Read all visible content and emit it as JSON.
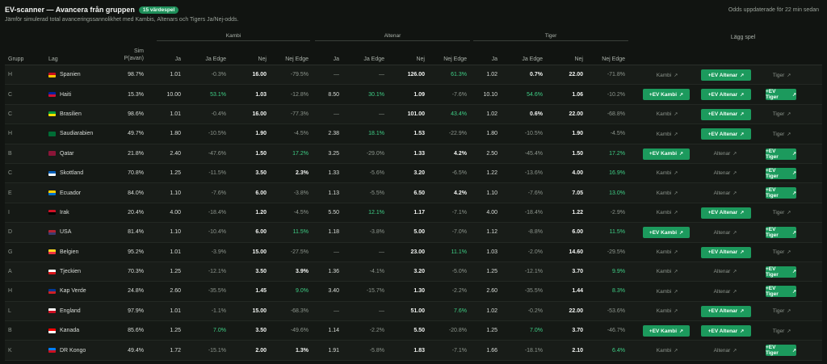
{
  "header": {
    "title": "EV-scanner — Avancera från gruppen",
    "badge": "15 värdespel",
    "subtitle": "Jämför simulerad total avanceringssannolikhet med Kambis, Altenars och Tigers Ja/Nej-odds.",
    "updated": "Odds uppdaterade för 22 min sedan"
  },
  "groups": {
    "kambi": "Kambi",
    "altenar": "Altenar",
    "tiger": "Tiger",
    "add": "Lägg spel"
  },
  "columns": {
    "grupp": "Grupp",
    "lag": "Lag",
    "sim1": "Sim",
    "sim2": "P(avan)",
    "ja": "Ja",
    "ja_edge": "Ja Edge",
    "nej": "Nej",
    "nej_edge": "Nej Edge"
  },
  "buttons": {
    "arrow": "↗"
  },
  "rows": [
    {
      "group": "H",
      "team": "Spanien",
      "flag": [
        "#c60b1e",
        "#ffc400"
      ],
      "sim": "98.7%",
      "k": [
        "1.01",
        "-0.3%",
        "16.00",
        "-79.5%"
      ],
      "a": [
        "—",
        "—",
        "126.00",
        "61.3%"
      ],
      "t": [
        "1.02",
        "0.7%",
        "22.00",
        "-71.8%"
      ],
      "kc": [
        "",
        "neg",
        "b",
        "neg"
      ],
      "ac": [
        "dim",
        "dim",
        "b",
        "pos"
      ],
      "tc": [
        "",
        "posw",
        "b",
        "neg"
      ],
      "btn": [
        {
          "label": "Kambi",
          "ev": false
        },
        {
          "label": "+EV Altenar",
          "ev": true
        },
        {
          "label": "Tiger",
          "ev": false
        }
      ]
    },
    {
      "group": "C",
      "team": "Haiti",
      "flag": [
        "#00209f",
        "#d21034"
      ],
      "sim": "15.3%",
      "k": [
        "10.00",
        "53.1%",
        "1.03",
        "-12.8%"
      ],
      "a": [
        "8.50",
        "30.1%",
        "1.09",
        "-7.6%"
      ],
      "t": [
        "10.10",
        "54.6%",
        "1.06",
        "-10.2%"
      ],
      "kc": [
        "",
        "pos",
        "b",
        "neg"
      ],
      "ac": [
        "",
        "pos",
        "b",
        "neg"
      ],
      "tc": [
        "",
        "pos",
        "b",
        "neg"
      ],
      "btn": [
        {
          "label": "+EV Kambi",
          "ev": true
        },
        {
          "label": "+EV Altenar",
          "ev": true
        },
        {
          "label": "+EV Tiger",
          "ev": true
        }
      ]
    },
    {
      "group": "C",
      "team": "Brasilien",
      "flag": [
        "#009c3b",
        "#ffdf00"
      ],
      "sim": "98.6%",
      "k": [
        "1.01",
        "-0.4%",
        "16.00",
        "-77.3%"
      ],
      "a": [
        "—",
        "—",
        "101.00",
        "43.4%"
      ],
      "t": [
        "1.02",
        "0.6%",
        "22.00",
        "-68.8%"
      ],
      "kc": [
        "",
        "neg",
        "b",
        "neg"
      ],
      "ac": [
        "dim",
        "dim",
        "b",
        "pos"
      ],
      "tc": [
        "",
        "posw",
        "b",
        "neg"
      ],
      "btn": [
        {
          "label": "Kambi",
          "ev": false
        },
        {
          "label": "+EV Altenar",
          "ev": true
        },
        {
          "label": "Tiger",
          "ev": false
        }
      ]
    },
    {
      "group": "H",
      "team": "Saudiarabien",
      "flag": [
        "#006c35",
        "#006c35"
      ],
      "sim": "49.7%",
      "k": [
        "1.80",
        "-10.5%",
        "1.90",
        "-4.5%"
      ],
      "a": [
        "2.38",
        "18.1%",
        "1.53",
        "-22.9%"
      ],
      "t": [
        "1.80",
        "-10.5%",
        "1.90",
        "-4.5%"
      ],
      "kc": [
        "",
        "neg",
        "b",
        "neg"
      ],
      "ac": [
        "",
        "pos",
        "b",
        "neg"
      ],
      "tc": [
        "",
        "neg",
        "b",
        "neg"
      ],
      "btn": [
        {
          "label": "Kambi",
          "ev": false
        },
        {
          "label": "+EV Altenar",
          "ev": true
        },
        {
          "label": "Tiger",
          "ev": false
        }
      ]
    },
    {
      "group": "B",
      "team": "Qatar",
      "flag": [
        "#8a1538",
        "#8a1538"
      ],
      "sim": "21.8%",
      "k": [
        "2.40",
        "-47.6%",
        "1.50",
        "17.2%"
      ],
      "a": [
        "3.25",
        "-29.0%",
        "1.33",
        "4.2%"
      ],
      "t": [
        "2.50",
        "-45.4%",
        "1.50",
        "17.2%"
      ],
      "kc": [
        "",
        "neg",
        "b",
        "pos"
      ],
      "ac": [
        "",
        "neg",
        "b",
        "posw"
      ],
      "tc": [
        "",
        "neg",
        "b",
        "pos"
      ],
      "btn": [
        {
          "label": "+EV Kambi",
          "ev": true
        },
        {
          "label": "Altenar",
          "ev": false
        },
        {
          "label": "+EV Tiger",
          "ev": true
        }
      ]
    },
    {
      "group": "C",
      "team": "Skottland",
      "flag": [
        "#005eb8",
        "#ffffff"
      ],
      "sim": "70.8%",
      "k": [
        "1.25",
        "-11.5%",
        "3.50",
        "2.3%"
      ],
      "a": [
        "1.33",
        "-5.6%",
        "3.20",
        "-6.5%"
      ],
      "t": [
        "1.22",
        "-13.6%",
        "4.00",
        "16.9%"
      ],
      "kc": [
        "",
        "neg",
        "b",
        "posw"
      ],
      "ac": [
        "",
        "neg",
        "b",
        "neg"
      ],
      "tc": [
        "",
        "neg",
        "b",
        "pos"
      ],
      "btn": [
        {
          "label": "Kambi",
          "ev": false
        },
        {
          "label": "Altenar",
          "ev": false
        },
        {
          "label": "+EV Tiger",
          "ev": true
        }
      ]
    },
    {
      "group": "E",
      "team": "Ecuador",
      "flag": [
        "#ffd100",
        "#0072ce"
      ],
      "sim": "84.0%",
      "k": [
        "1.10",
        "-7.6%",
        "6.00",
        "-3.8%"
      ],
      "a": [
        "1.13",
        "-5.5%",
        "6.50",
        "4.2%"
      ],
      "t": [
        "1.10",
        "-7.6%",
        "7.05",
        "13.0%"
      ],
      "kc": [
        "",
        "neg",
        "b",
        "neg"
      ],
      "ac": [
        "",
        "neg",
        "b",
        "posw"
      ],
      "tc": [
        "",
        "neg",
        "b",
        "pos"
      ],
      "btn": [
        {
          "label": "Kambi",
          "ev": false
        },
        {
          "label": "Altenar",
          "ev": false
        },
        {
          "label": "+EV Tiger",
          "ev": true
        }
      ]
    },
    {
      "group": "I",
      "team": "Irak",
      "flag": [
        "#ce1126",
        "#000000"
      ],
      "sim": "20.4%",
      "k": [
        "4.00",
        "-18.4%",
        "1.20",
        "-4.5%"
      ],
      "a": [
        "5.50",
        "12.1%",
        "1.17",
        "-7.1%"
      ],
      "t": [
        "4.00",
        "-18.4%",
        "1.22",
        "-2.9%"
      ],
      "kc": [
        "",
        "neg",
        "b",
        "neg"
      ],
      "ac": [
        "",
        "pos",
        "b",
        "neg"
      ],
      "tc": [
        "",
        "neg",
        "b",
        "neg"
      ],
      "btn": [
        {
          "label": "Kambi",
          "ev": false
        },
        {
          "label": "+EV Altenar",
          "ev": true
        },
        {
          "label": "Tiger",
          "ev": false
        }
      ]
    },
    {
      "group": "D",
      "team": "USA",
      "flag": [
        "#b22234",
        "#3c3b6e"
      ],
      "sim": "81.4%",
      "k": [
        "1.10",
        "-10.4%",
        "6.00",
        "11.5%"
      ],
      "a": [
        "1.18",
        "-3.8%",
        "5.00",
        "-7.0%"
      ],
      "t": [
        "1.12",
        "-8.8%",
        "6.00",
        "11.5%"
      ],
      "kc": [
        "",
        "neg",
        "b",
        "pos"
      ],
      "ac": [
        "",
        "neg",
        "b",
        "neg"
      ],
      "tc": [
        "",
        "neg",
        "b",
        "pos"
      ],
      "btn": [
        {
          "label": "+EV Kambi",
          "ev": true
        },
        {
          "label": "Altenar",
          "ev": false
        },
        {
          "label": "+EV Tiger",
          "ev": true
        }
      ]
    },
    {
      "group": "G",
      "team": "Belgien",
      "flag": [
        "#fdda24",
        "#ef3340"
      ],
      "sim": "95.2%",
      "k": [
        "1.01",
        "-3.9%",
        "15.00",
        "-27.5%"
      ],
      "a": [
        "—",
        "—",
        "23.00",
        "11.1%"
      ],
      "t": [
        "1.03",
        "-2.0%",
        "14.60",
        "-29.5%"
      ],
      "kc": [
        "",
        "neg",
        "b",
        "neg"
      ],
      "ac": [
        "dim",
        "dim",
        "b",
        "pos"
      ],
      "tc": [
        "",
        "neg",
        "b",
        "neg"
      ],
      "btn": [
        {
          "label": "Kambi",
          "ev": false
        },
        {
          "label": "+EV Altenar",
          "ev": true
        },
        {
          "label": "Tiger",
          "ev": false
        }
      ]
    },
    {
      "group": "A",
      "team": "Tjeckien",
      "flag": [
        "#ffffff",
        "#d7141a"
      ],
      "sim": "70.3%",
      "k": [
        "1.25",
        "-12.1%",
        "3.50",
        "3.9%"
      ],
      "a": [
        "1.36",
        "-4.1%",
        "3.20",
        "-5.0%"
      ],
      "t": [
        "1.25",
        "-12.1%",
        "3.70",
        "9.9%"
      ],
      "kc": [
        "",
        "neg",
        "b",
        "posw"
      ],
      "ac": [
        "",
        "neg",
        "b",
        "neg"
      ],
      "tc": [
        "",
        "neg",
        "b",
        "pos"
      ],
      "btn": [
        {
          "label": "Kambi",
          "ev": false
        },
        {
          "label": "Altenar",
          "ev": false
        },
        {
          "label": "+EV Tiger",
          "ev": true
        }
      ]
    },
    {
      "group": "H",
      "team": "Kap Verde",
      "flag": [
        "#003893",
        "#cf2027"
      ],
      "sim": "24.8%",
      "k": [
        "2.60",
        "-35.5%",
        "1.45",
        "9.0%"
      ],
      "a": [
        "3.40",
        "-15.7%",
        "1.30",
        "-2.2%"
      ],
      "t": [
        "2.60",
        "-35.5%",
        "1.44",
        "8.3%"
      ],
      "kc": [
        "",
        "neg",
        "b",
        "pos"
      ],
      "ac": [
        "",
        "neg",
        "b",
        "neg"
      ],
      "tc": [
        "",
        "neg",
        "b",
        "pos"
      ],
      "btn": [
        {
          "label": "Kambi",
          "ev": false
        },
        {
          "label": "Altenar",
          "ev": false
        },
        {
          "label": "+EV Tiger",
          "ev": true
        }
      ]
    },
    {
      "group": "L",
      "team": "England",
      "flag": [
        "#ffffff",
        "#ce1124"
      ],
      "sim": "97.9%",
      "k": [
        "1.01",
        "-1.1%",
        "15.00",
        "-68.3%"
      ],
      "a": [
        "—",
        "—",
        "51.00",
        "7.6%"
      ],
      "t": [
        "1.02",
        "-0.2%",
        "22.00",
        "-53.6%"
      ],
      "kc": [
        "",
        "neg",
        "b",
        "neg"
      ],
      "ac": [
        "dim",
        "dim",
        "b",
        "pos"
      ],
      "tc": [
        "",
        "neg",
        "b",
        "neg"
      ],
      "btn": [
        {
          "label": "Kambi",
          "ev": false
        },
        {
          "label": "+EV Altenar",
          "ev": true
        },
        {
          "label": "Tiger",
          "ev": false
        }
      ]
    },
    {
      "group": "B",
      "team": "Kanada",
      "flag": [
        "#ff0000",
        "#ffffff"
      ],
      "sim": "85.6%",
      "k": [
        "1.25",
        "7.0%",
        "3.50",
        "-49.6%"
      ],
      "a": [
        "1.14",
        "-2.2%",
        "5.50",
        "-20.8%"
      ],
      "t": [
        "1.25",
        "7.0%",
        "3.70",
        "-46.7%"
      ],
      "kc": [
        "",
        "pos",
        "b",
        "neg"
      ],
      "ac": [
        "",
        "neg",
        "b",
        "neg"
      ],
      "tc": [
        "",
        "pos",
        "b",
        "neg"
      ],
      "btn": [
        {
          "label": "+EV Kambi",
          "ev": true
        },
        {
          "label": "+EV Altenar",
          "ev": true
        },
        {
          "label": "Tiger",
          "ev": false
        }
      ]
    },
    {
      "group": "K",
      "team": "DR Kongo",
      "flag": [
        "#007fff",
        "#ce1021"
      ],
      "sim": "49.4%",
      "k": [
        "1.72",
        "-15.1%",
        "2.00",
        "1.3%"
      ],
      "a": [
        "1.91",
        "-5.8%",
        "1.83",
        "-7.1%"
      ],
      "t": [
        "1.66",
        "-18.1%",
        "2.10",
        "6.4%"
      ],
      "kc": [
        "",
        "neg",
        "b",
        "posw"
      ],
      "ac": [
        "",
        "neg",
        "b",
        "neg"
      ],
      "tc": [
        "",
        "neg",
        "b",
        "pos"
      ],
      "btn": [
        {
          "label": "Kambi",
          "ev": false
        },
        {
          "label": "Altenar",
          "ev": false
        },
        {
          "label": "+EV Tiger",
          "ev": true
        }
      ]
    }
  ]
}
